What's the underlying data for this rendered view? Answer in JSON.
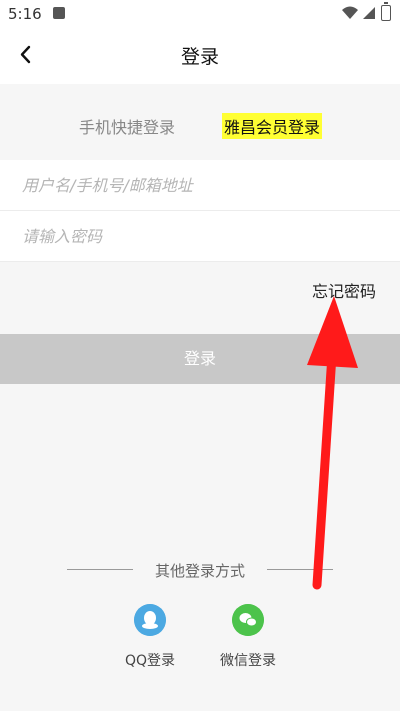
{
  "status_bar": {
    "time": "5:16",
    "icons": [
      "notification-a-icon",
      "wifi-icon",
      "signal-icon",
      "battery-charging-icon"
    ]
  },
  "header": {
    "title": "登录",
    "back_icon": "chevron-left-icon"
  },
  "tabs": [
    {
      "label": "手机快捷登录",
      "active": false
    },
    {
      "label": "雅昌会员登录",
      "active": true
    }
  ],
  "form": {
    "username_placeholder": "用户名/手机号/邮箱地址",
    "username_value": "",
    "password_placeholder": "请输入密码",
    "password_value": "",
    "forgot_label": "忘记密码",
    "login_label": "登录"
  },
  "other_login": {
    "title": "其他登录方式",
    "options": [
      {
        "label": "QQ登录",
        "icon": "qq-icon"
      },
      {
        "label": "微信登录",
        "icon": "wechat-icon"
      }
    ]
  },
  "colors": {
    "active_tab_highlight": "#ffff33",
    "login_button": "#c8c8c8",
    "qq": "#4ca9e2",
    "wechat": "#4cc34b",
    "annotation_arrow": "#ff1a1a"
  }
}
